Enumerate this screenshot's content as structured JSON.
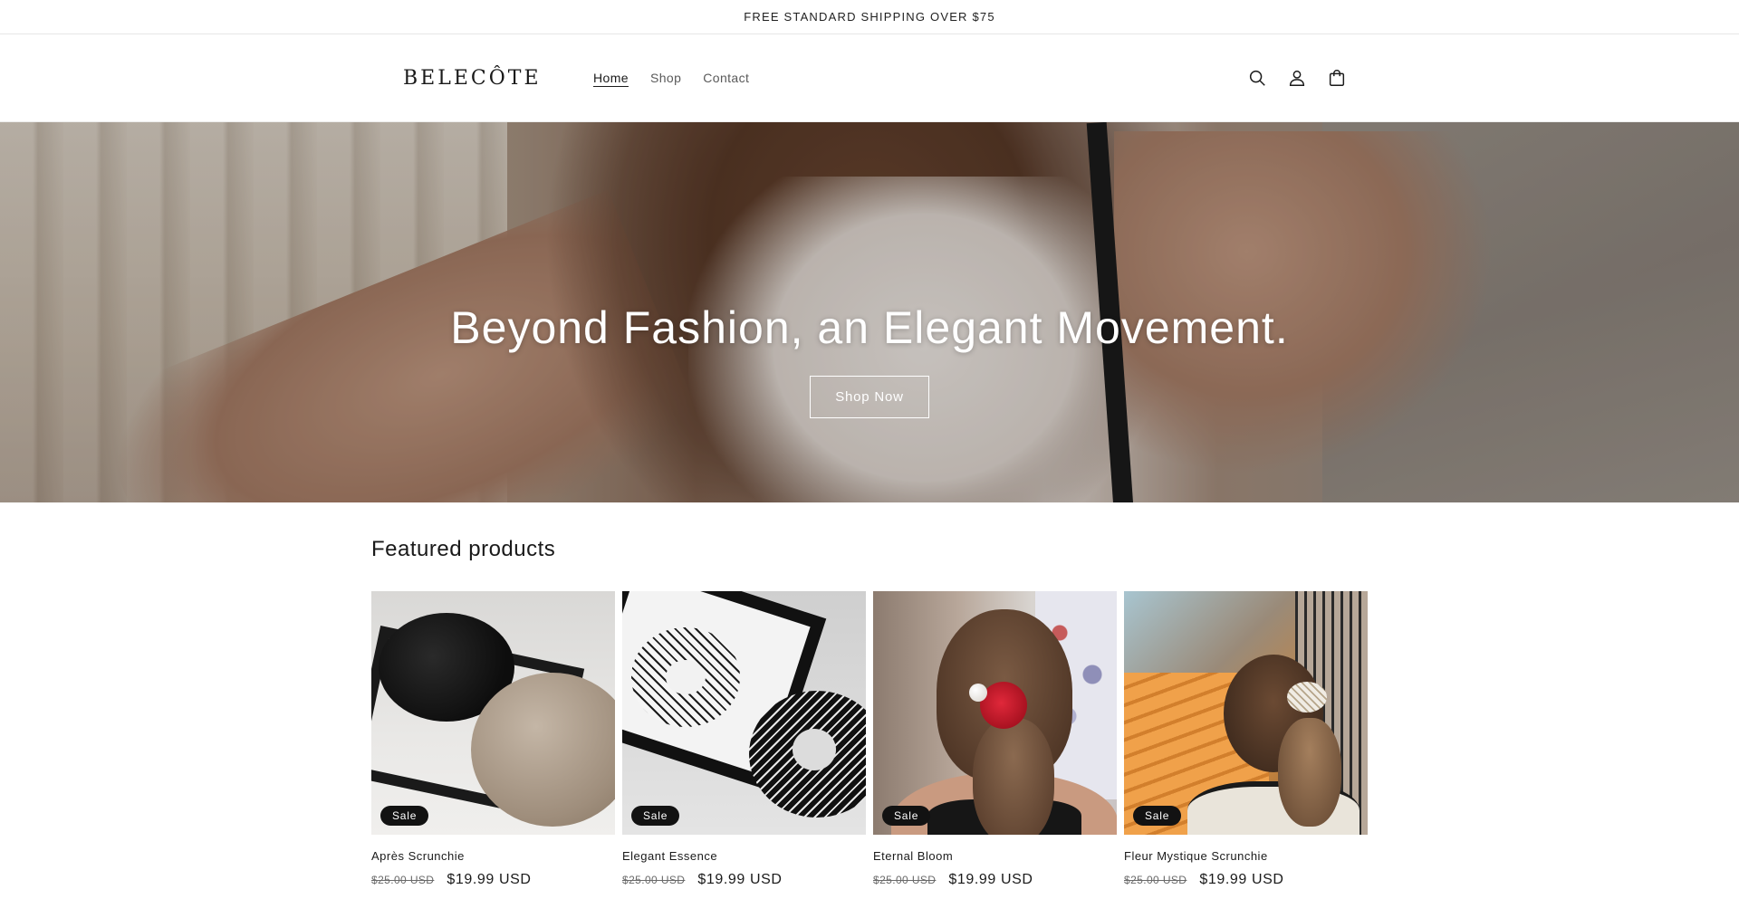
{
  "announcement": "FREE STANDARD SHIPPING OVER $75",
  "header": {
    "logo": "BELECÔTE",
    "nav": [
      {
        "label": "Home",
        "active": true
      },
      {
        "label": "Shop",
        "active": false
      },
      {
        "label": "Contact",
        "active": false
      }
    ],
    "icons": [
      "search-icon",
      "account-icon",
      "cart-icon"
    ]
  },
  "hero": {
    "title": "Beyond Fashion, an Elegant Movement.",
    "button_label": "Shop Now"
  },
  "featured": {
    "heading": "Featured products",
    "products": [
      {
        "name": "Après Scrunchie",
        "badge": "Sale",
        "price_old": "$25.00 USD",
        "price_new": "$19.99 USD"
      },
      {
        "name": "Elegant Essence",
        "badge": "Sale",
        "price_old": "$25.00 USD",
        "price_new": "$19.99 USD"
      },
      {
        "name": "Eternal Bloom",
        "badge": "Sale",
        "price_old": "$25.00 USD",
        "price_new": "$19.99 USD"
      },
      {
        "name": "Fleur Mystique Scrunchie",
        "badge": "Sale",
        "price_old": "$25.00 USD",
        "price_new": "$19.99 USD"
      }
    ]
  },
  "colors": {
    "text": "#121212",
    "badge_bg": "#121212",
    "hero_button_border": "#ffffff"
  }
}
